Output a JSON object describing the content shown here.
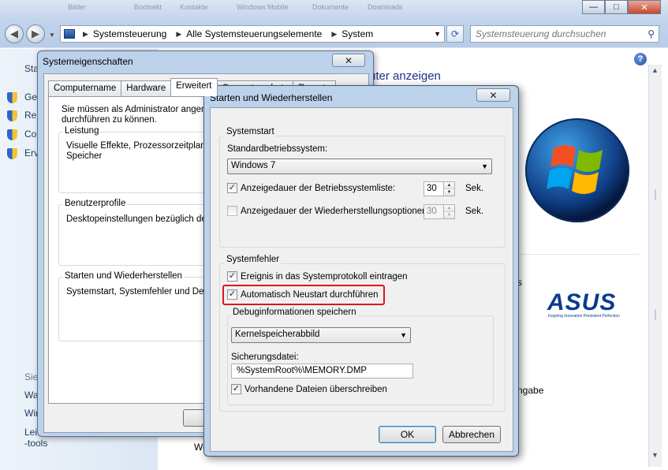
{
  "explorer": {
    "top_strip": [
      "Bilder",
      "Bootsekt",
      "Kontakte",
      "Windows Mobile",
      "Dokumente",
      "Downloads"
    ],
    "caption_buttons": {
      "minimize": "—",
      "maximize": "□",
      "close": "✕"
    },
    "nav": {
      "back": "◀",
      "forward": "▶"
    },
    "breadcrumbs": [
      "Systemsteuerung",
      "Alle Systemsteuerungselemente",
      "System"
    ],
    "search_placeholder": "Systemsteuerung durchsuchen",
    "main_heading_fragment": "uter anzeigen",
    "left_fragments": [
      "Sta",
      "Ge",
      "Re",
      "Co",
      "Erv",
      "Sie",
      "Wa",
      "Win",
      "Lei",
      "-tools"
    ],
    "right_fragments": [
      "s",
      "ngabe",
      "We"
    ],
    "asus": {
      "name": "ASUS",
      "tagline": "Inspiring Innovation  Persistent Perfection"
    },
    "help": "?"
  },
  "sysprops": {
    "title": "Systemeigenschaften",
    "tabs": [
      "Computername",
      "Hardware",
      "Erweitert",
      "Computerschutz",
      "Remote"
    ],
    "active_tab": "Erweitert",
    "admin_note_line1": "Sie müssen als Administrator angemeldet sein, um diese Änderungen",
    "admin_note_line2": "durchführen zu können.",
    "groups": [
      {
        "label": "Leistung",
        "text_line1": "Visuelle Effekte, Prozessorzeitplanung, Speichernutzung und virtueller",
        "text_line2": "Speicher"
      },
      {
        "label": "Benutzerprofile",
        "text_line1": "Desktopeinstellungen bezüglich der Anmeldung",
        "text_line2": ""
      },
      {
        "label": "Starten und Wiederherstellen",
        "text_line1": "Systemstart, Systemfehler und Debuginformationen",
        "text_line2": ""
      }
    ],
    "ok_button": "OK"
  },
  "startup": {
    "title": "Starten und Wiederherstellen",
    "systemstart": {
      "label": "Systemstart",
      "default_os_label": "Standardbetriebssystem:",
      "default_os_value": "Windows 7",
      "show_os_list": {
        "label": "Anzeigedauer der Betriebssystemliste:",
        "checked": true,
        "value": "30",
        "unit": "Sek."
      },
      "show_recovery": {
        "label": "Anzeigedauer der Wiederherstellungsoptionen:",
        "checked": false,
        "value": "30",
        "unit": "Sek."
      }
    },
    "systemfehler": {
      "label": "Systemfehler",
      "log_event": {
        "label": "Ereignis in das Systemprotokoll eintragen",
        "checked": true
      },
      "auto_restart": {
        "label": "Automatisch Neustart durchführen",
        "checked": true
      },
      "debug": {
        "label": "Debuginformationen speichern",
        "type_value": "Kernelspeicherabbild",
        "dump_file_label": "Sicherungsdatei:",
        "dump_file_value": "%SystemRoot%\\MEMORY.DMP",
        "overwrite": {
          "label": "Vorhandene Dateien überschreiben",
          "checked": true
        }
      }
    },
    "ok_button": "OK",
    "cancel_button": "Abbrechen",
    "check_mark": "✓",
    "close_glyph": "✕",
    "spin_up": "▲",
    "spin_down": "▼",
    "dropdown_glyph": "▼"
  }
}
